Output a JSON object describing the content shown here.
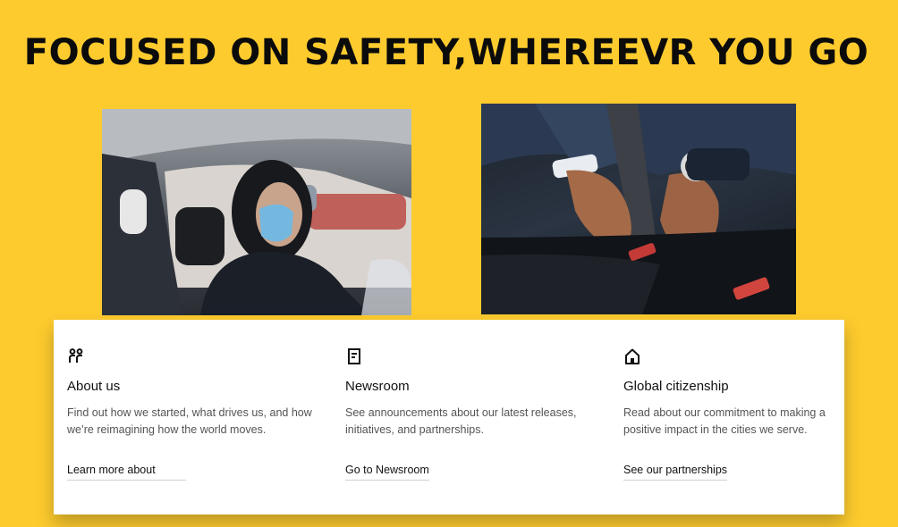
{
  "headline": "FOCUSED ON SAFETY,WHEREEVR YOU GO",
  "photos": [
    {
      "name": "masked-driver-photo"
    },
    {
      "name": "seatbelt-buckle-photo"
    }
  ],
  "cards": [
    {
      "icon": "people-icon",
      "title": "About us",
      "description": "Find out how we started, what drives us, and how we’re reimagining how the world moves.",
      "link": "Learn more about"
    },
    {
      "icon": "document-icon",
      "title": "Newsroom",
      "description": "See announcements about our latest releases, initiatives, and partnerships.",
      "link": "Go to Newsroom"
    },
    {
      "icon": "home-icon",
      "title": "Global citizenship",
      "description": "Read about our commitment to making a positive impact in the cities we serve.",
      "link": "See our partnerships"
    }
  ],
  "colors": {
    "background": "#fdcb2e",
    "card": "#ffffff",
    "text": "#111111"
  }
}
